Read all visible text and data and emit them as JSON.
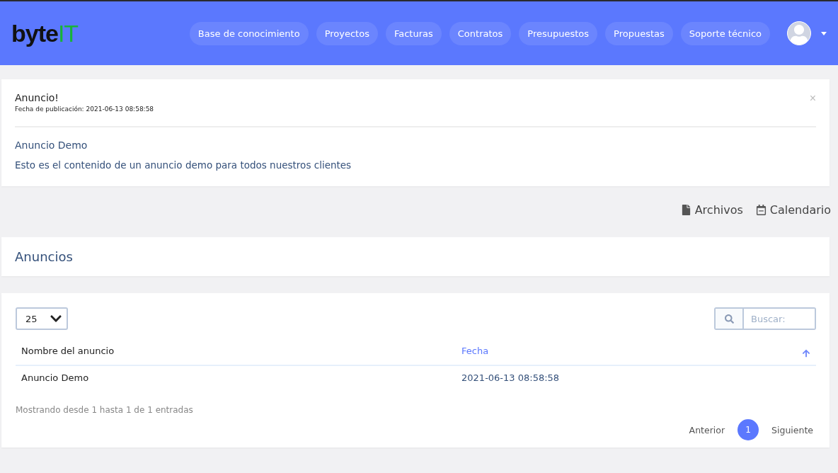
{
  "logo": {
    "text": "byte",
    "accent": "IT"
  },
  "nav": [
    {
      "label": "Base de conocimiento"
    },
    {
      "label": "Proyectos"
    },
    {
      "label": "Facturas"
    },
    {
      "label": "Contratos"
    },
    {
      "label": "Presupuestos"
    },
    {
      "label": "Propuestas"
    },
    {
      "label": "Soporte técnico"
    }
  ],
  "announcement": {
    "close": "×",
    "title": "Anuncio!",
    "date": "Fecha de publicación: 2021-06-13 08:58:58",
    "heading": "Anuncio Demo",
    "body": "Esto es el contenido de un anuncio demo para todos nuestros clientes"
  },
  "links": [
    {
      "kind": "file",
      "label": "Archivos"
    },
    {
      "kind": "calendar",
      "label": "Calendario"
    }
  ],
  "section_title": "Anuncios",
  "table": {
    "page_size": "25",
    "search": {
      "placeholder": "Buscar:"
    },
    "columns": [
      {
        "label": "Nombre del anuncio",
        "sorted": false
      },
      {
        "label": "Fecha",
        "sorted": true
      }
    ],
    "rows": [
      [
        "Anuncio Demo",
        "2021-06-13 08:58:58"
      ]
    ],
    "info": "Mostrando desde 1 hasta 1 de 1 entradas",
    "pagination": {
      "previous": "Anterior",
      "pages": [
        {
          "label": "1",
          "selected": true
        }
      ],
      "next": "Siguiente"
    }
  }
}
